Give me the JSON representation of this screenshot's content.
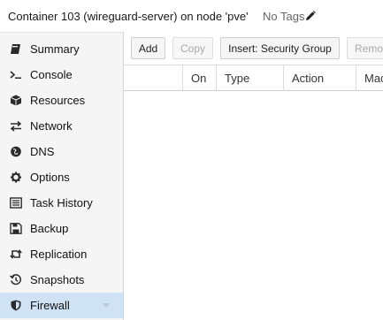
{
  "header": {
    "title": "Container 103 (wireguard-server) on node 'pve'",
    "tags": "No Tags"
  },
  "sidebar": {
    "items": [
      {
        "label": "Summary",
        "icon": "book-icon"
      },
      {
        "label": "Console",
        "icon": "terminal-icon"
      },
      {
        "label": "Resources",
        "icon": "cube-icon"
      },
      {
        "label": "Network",
        "icon": "exchange-icon"
      },
      {
        "label": "DNS",
        "icon": "globe-icon"
      },
      {
        "label": "Options",
        "icon": "gear-icon"
      },
      {
        "label": "Task History",
        "icon": "list-icon"
      },
      {
        "label": "Backup",
        "icon": "floppy-icon"
      },
      {
        "label": "Replication",
        "icon": "retweet-icon"
      },
      {
        "label": "Snapshots",
        "icon": "history-icon"
      },
      {
        "label": "Firewall",
        "icon": "shield-icon",
        "active": true
      }
    ]
  },
  "toolbar": {
    "add_label": "Add",
    "copy_label": "Copy",
    "insert_label": "Insert: Security Group",
    "remove_label": "Remo"
  },
  "grid": {
    "columns": [
      "",
      "On",
      "Type",
      "Action",
      "Mac"
    ]
  },
  "colors": {
    "active_bg": "#cfe3f5",
    "sidebar_bg": "#f5f5f5"
  }
}
